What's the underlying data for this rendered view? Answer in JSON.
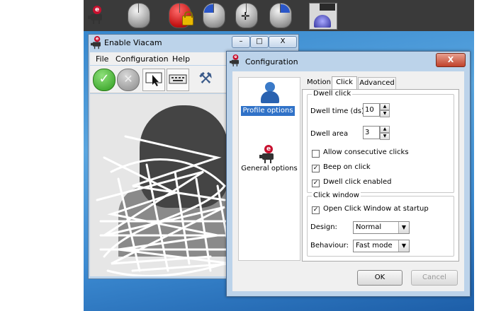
{
  "viacam_window": {
    "title": "Enable Viacam",
    "menu": [
      "File",
      "Configuration",
      "Help"
    ],
    "minimize": "–",
    "maximize": "□",
    "close": "X"
  },
  "config_dialog": {
    "title": "Configuration",
    "close": "X",
    "sidebar": {
      "profile_options": "Profile options",
      "general_options": "General options"
    },
    "tabs": [
      "Motion",
      "Click",
      "Advanced"
    ],
    "dwell_click": {
      "group_label": "Dwell click",
      "dwell_time_label": "Dwell time (ds)",
      "dwell_time_value": "10",
      "dwell_area_label": "Dwell area",
      "dwell_area_value": "3",
      "allow_consecutive_label": "Allow consecutive clicks",
      "allow_consecutive_checked": false,
      "beep_label": "Beep on click",
      "beep_checked": true,
      "dwell_enabled_label": "Dwell click enabled",
      "dwell_enabled_checked": true
    },
    "click_window": {
      "group_label": "Click window",
      "open_at_startup_label": "Open Click Window at startup",
      "open_at_startup_checked": true,
      "design_label": "Design:",
      "design_value": "Normal",
      "behaviour_label": "Behaviour:",
      "behaviour_value": "Fast mode"
    },
    "buttons": {
      "ok": "OK",
      "cancel": "Cancel"
    }
  },
  "icons": {
    "check": "✓",
    "cross": "✕",
    "move": "✛",
    "tools": "⚒",
    "spin_up": "▲",
    "spin_down": "▼",
    "dropdown": "▼"
  },
  "colors": {
    "selection": "#3072c8",
    "desktop": "#3c8bd2"
  }
}
